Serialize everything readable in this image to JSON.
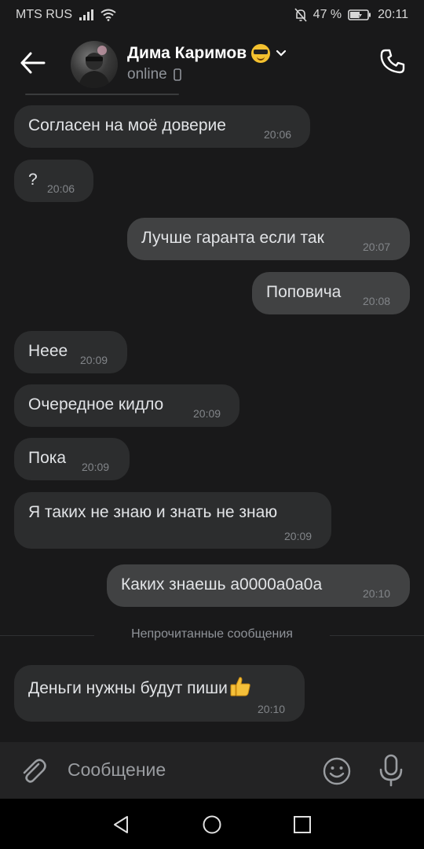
{
  "status_bar": {
    "carrier": "MTS RUS",
    "battery": "47 %",
    "time": "20:11"
  },
  "header": {
    "name": "Дима Каримов",
    "status": "online"
  },
  "messages": [
    {
      "text": "Согласен на моё доверие",
      "time": "20:06",
      "direction": "in"
    },
    {
      "text": "?",
      "time": "20:06",
      "direction": "in"
    },
    {
      "text": "Лучше гаранта если так",
      "time": "20:07",
      "direction": "out"
    },
    {
      "text": "Поповича",
      "time": "20:08",
      "direction": "out"
    },
    {
      "text": "Неее",
      "time": "20:09",
      "direction": "in"
    },
    {
      "text": "Очередное кидло",
      "time": "20:09",
      "direction": "in"
    },
    {
      "text": "Пока",
      "time": "20:09",
      "direction": "in"
    },
    {
      "text": "Я таких не знаю и знать не знаю",
      "time": "20:09",
      "direction": "in"
    },
    {
      "text": "Каких знаешь а0000а0а0а",
      "time": "20:10",
      "direction": "out"
    },
    {
      "text": "Деньги нужны будут пиши",
      "time": "20:10",
      "direction": "in",
      "emoji": "thumbs-up"
    }
  ],
  "unread_divider": "Непрочитанные сообщения",
  "composer": {
    "placeholder": "Сообщение"
  },
  "colors": {
    "background": "#19191a",
    "incoming_bubble": "#2c2d2e",
    "outgoing_bubble": "#414243",
    "composer": "#232324"
  }
}
